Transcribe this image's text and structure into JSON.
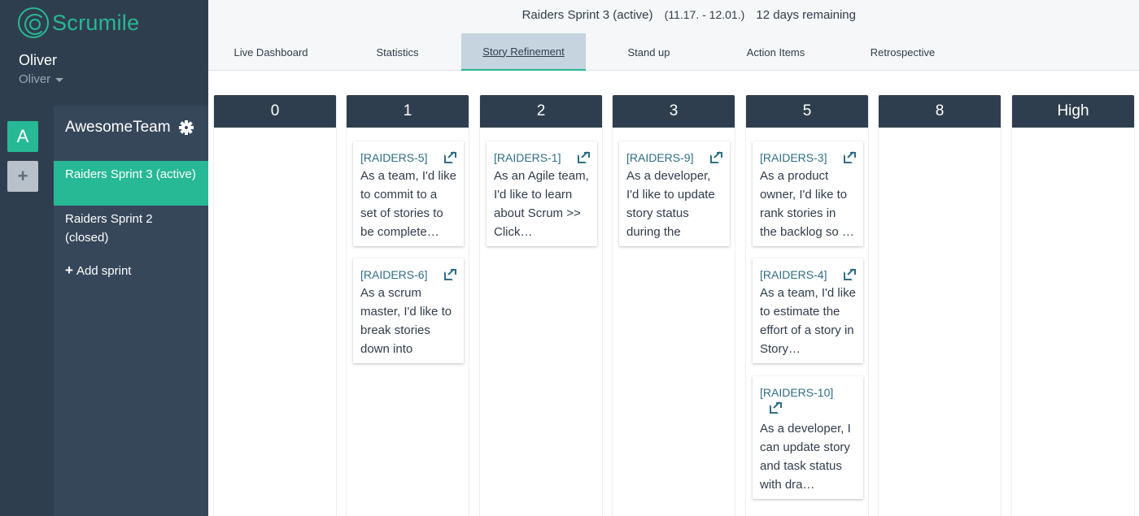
{
  "app": {
    "logo_text": "Scrumile",
    "brand_color": "#27b895",
    "nav_color": "#2f3e4e"
  },
  "user": {
    "name": "Oliver",
    "menu_label": "Oliver"
  },
  "teams": {
    "avatar_letter": "A",
    "add_label": "+"
  },
  "team": {
    "name": "AwesomeTeam",
    "sprints": [
      {
        "label": "Raiders Sprint 3 (active)",
        "active": true
      },
      {
        "label": "Raiders Sprint 2 (closed)",
        "active": false
      }
    ],
    "add_sprint_label": "Add sprint"
  },
  "header": {
    "sprint_name": "Raiders Sprint 3 (active)",
    "dates": "(11.17. - 12.01.)",
    "remaining": "12 days remaining"
  },
  "tabs": [
    {
      "label": "Live Dashboard"
    },
    {
      "label": "Statistics"
    },
    {
      "label": "Story Refinement",
      "active": true
    },
    {
      "label": "Stand up"
    },
    {
      "label": "Action Items"
    },
    {
      "label": "Retrospective"
    }
  ],
  "columns": [
    {
      "label": "0",
      "cards": []
    },
    {
      "label": "1",
      "cards": [
        {
          "key": "[RAIDERS-5]",
          "text": "As a team, I'd like to commit to a set of stories to be complete…"
        },
        {
          "key": "[RAIDERS-6]",
          "text": "As a scrum master, I'd like to break stories down into tasks…"
        }
      ]
    },
    {
      "label": "2",
      "cards": [
        {
          "key": "[RAIDERS-1]",
          "text": "As an Agile team, I'd like to learn about Scrum >> Click…"
        }
      ]
    },
    {
      "label": "3",
      "cards": [
        {
          "key": "[RAIDERS-9]",
          "text": "As a developer, I'd like to update story status during the sprin…"
        }
      ]
    },
    {
      "label": "5",
      "cards": [
        {
          "key": "[RAIDERS-3]",
          "text": "As a product owner, I'd like to rank stories in the backlog so …"
        },
        {
          "key": "[RAIDERS-4]",
          "text": "As a team, I'd like to estimate the effort of a story in Story…"
        },
        {
          "key": "[RAIDERS-10]",
          "text": "As a developer, I can update story and task status with dra…"
        }
      ]
    },
    {
      "label": "8",
      "cards": []
    },
    {
      "label": "High",
      "cards": []
    }
  ]
}
